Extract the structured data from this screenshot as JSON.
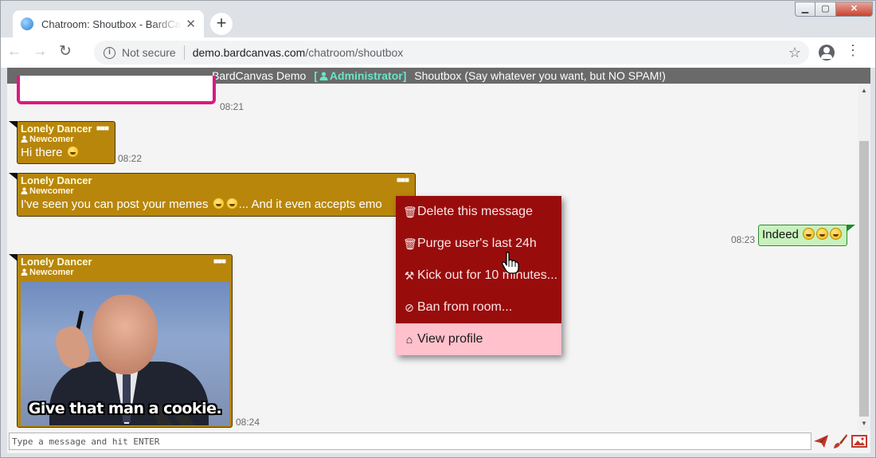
{
  "browser": {
    "tab_title": "Chatroom: Shoutbox - BardCanvas",
    "tab_close": "✕",
    "new_tab": "+",
    "security_label": "Not secure",
    "url_host": "demo.bardcanvas.com",
    "url_path": "/chatroom/shoutbox",
    "icons": [
      "globe-icon",
      "back-icon",
      "forward-icon",
      "reload-icon",
      "info-icon",
      "star-icon",
      "profile-icon",
      "menu-icon"
    ]
  },
  "room": {
    "site": "BardCanvas Demo",
    "role": "Administrator",
    "title": "Shoutbox (Say whatever you want, but NO SPAM!)"
  },
  "messages": [
    {
      "time": "08:21"
    },
    {
      "author": "Lonely Dancer",
      "badge": "Newcomer",
      "text": "Hi there",
      "time": "08:22"
    },
    {
      "author": "Lonely Dancer",
      "badge": "Newcomer",
      "text_before": "I've seen you can post your memes",
      "text_after": "... And it even accepts emo",
      "time": ""
    },
    {
      "author": "Lonely Dancer",
      "badge": "Newcomer",
      "meme_caption": "Give that man a cookie.",
      "time": "08:24"
    }
  ],
  "own_message": {
    "text": "Indeed",
    "time": "08:23"
  },
  "context_menu": [
    {
      "icon": "trash-icon",
      "label": "Delete this message"
    },
    {
      "icon": "trash-icon",
      "label": "Purge user's last 24h"
    },
    {
      "icon": "gavel-icon",
      "label": "Kick out for 10 minutes..."
    },
    {
      "icon": "ban-icon",
      "label": "Ban from room..."
    },
    {
      "icon": "home-icon",
      "label": "View profile"
    }
  ],
  "composer": {
    "placeholder": "Type a message and hit ENTER",
    "buttons": [
      "send-icon",
      "brush-icon",
      "image-icon"
    ]
  },
  "colors": {
    "bubble": "#b8860b",
    "own_bubble": "#c9f1bd",
    "menu": "#990c0c",
    "menu_hover": "#ffc1cc",
    "role": "#68e6c8"
  }
}
